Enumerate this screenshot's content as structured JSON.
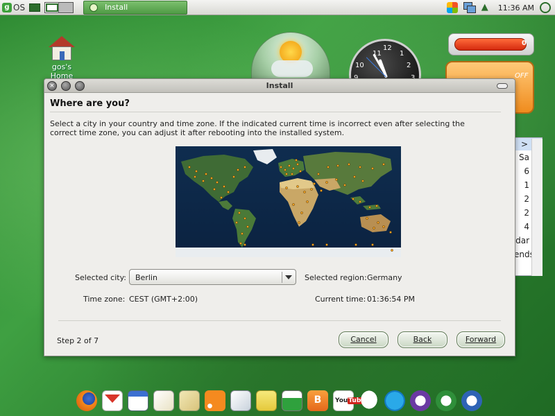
{
  "top_panel": {
    "logo_letter": "g",
    "logo_text": "OS",
    "task_button_label": "Install",
    "clock": "11:36 AM"
  },
  "desktop": {
    "home_icon_label": "gos's Home",
    "clock_gadget_numbers": [
      "11",
      "12",
      "1",
      "2",
      "3",
      "10",
      "9"
    ],
    "battery_value": "0",
    "toggle_gadget_label": "OFF",
    "calendar_fragments": [
      ">",
      "Sa",
      "6",
      "1",
      "2",
      "2",
      "4",
      "dar",
      "ends"
    ]
  },
  "install_window": {
    "title": "Install",
    "heading": "Where are you?",
    "description": "Select a city in your country and time zone. If the indicated current time is incorrect even after selecting the correct time zone, you can adjust it after rebooting into the installed system.",
    "selected_city_label": "Selected city:",
    "selected_city_value": "Berlin",
    "selected_region_label": "Selected region:",
    "selected_region_value": "Germany",
    "time_zone_label": "Time zone:",
    "time_zone_value": "CEST (GMT+2:00)",
    "current_time_label": "Current time:",
    "current_time_value": "01:36:54 PM",
    "step_text": "Step 2 of 7",
    "buttons": {
      "cancel": "Cancel",
      "back": "Back",
      "forward": "Forward"
    }
  },
  "dock": {
    "items": [
      "firefox-icon",
      "gmail-icon",
      "calendar-icon",
      "docs-icon",
      "maps-icon",
      "rss-icon",
      "news-icon",
      "shopping-icon",
      "photos-icon",
      "blogger-icon",
      "youtube-icon",
      "chat-icon",
      "skype-icon",
      "openoffice-writer-icon",
      "openoffice-calc-icon",
      "openoffice-impress-icon"
    ],
    "youtube_text_you": "You",
    "youtube_text_tube": "Tube",
    "blogger_glyph": "B"
  },
  "colors": {
    "desktop_green": "#3fa042",
    "window_bg": "#efeeeb",
    "map_ocean": "#0d2a4a",
    "city_dot": "#f0a020"
  }
}
